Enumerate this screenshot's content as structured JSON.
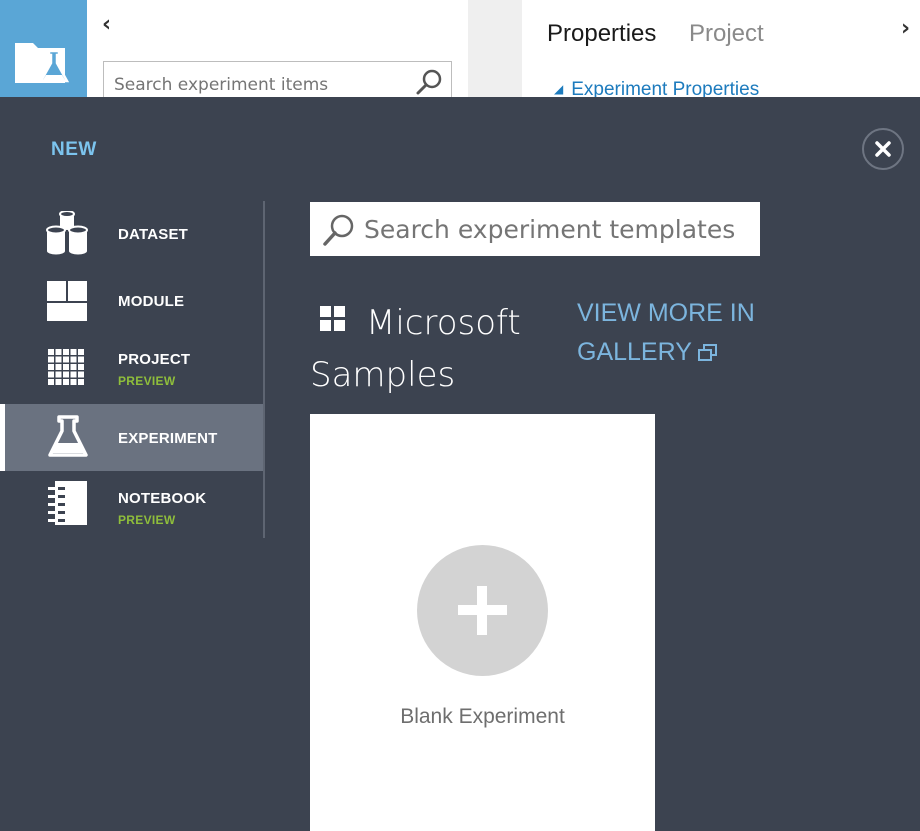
{
  "background": {
    "search": {
      "placeholder": "Search experiment items"
    },
    "tabs": [
      {
        "label": "Properties"
      },
      {
        "label": "Project"
      }
    ],
    "section_title": "Experiment Properties"
  },
  "overlay": {
    "title": "NEW",
    "nav": [
      {
        "label": "DATASET",
        "icon": "dataset-icon"
      },
      {
        "label": "MODULE",
        "icon": "module-icon"
      },
      {
        "label": "PROJECT",
        "badge": "PREVIEW",
        "icon": "project-icon"
      },
      {
        "label": "EXPERIMENT",
        "icon": "experiment-icon",
        "active": true
      },
      {
        "label": "NOTEBOOK",
        "badge": "PREVIEW",
        "icon": "notebook-icon"
      }
    ],
    "template_search": {
      "placeholder": "Search experiment templates"
    },
    "samples_title": "Microsoft Samples",
    "gallery_link": "VIEW MORE IN GALLERY",
    "blank_experiment": "Blank Experiment"
  },
  "colors": {
    "overlay_bg": "#3c4350",
    "active_item_bg": "#6a7280",
    "accent_blue": "#7cc4ee",
    "preview_green": "#8fbe3b",
    "app_tile": "#5aa6d6",
    "link_blue": "#1d7bbd"
  }
}
